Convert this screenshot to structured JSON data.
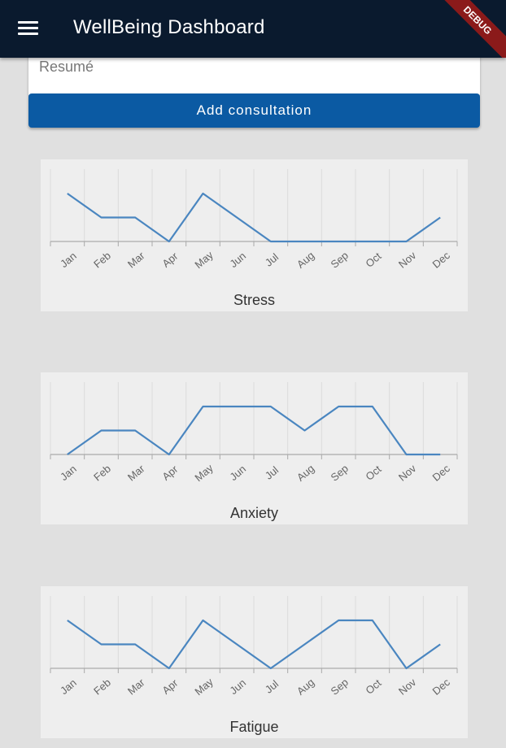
{
  "appbar": {
    "title": "WellBeing Dashboard",
    "menu_icon": "menu-icon",
    "debug_label": "DEBUG",
    "background": "#0a1a2e"
  },
  "form": {
    "resume_placeholder": "Resumé",
    "add_button_label": "Add consultation",
    "button_color": "#0b5aa3"
  },
  "chart_data": [
    {
      "type": "line",
      "title": "Stress",
      "categories": [
        "Jan",
        "Feb",
        "Mar",
        "Apr",
        "May",
        "Jun",
        "Jul",
        "Aug",
        "Sep",
        "Oct",
        "Nov",
        "Dec"
      ],
      "values": [
        2,
        1,
        1,
        0,
        2,
        1,
        0,
        0,
        0,
        0,
        0,
        1
      ],
      "ylim": [
        0,
        2.2
      ],
      "grid": true,
      "line_color": "#4a86c0"
    },
    {
      "type": "line",
      "title": "Anxiety",
      "categories": [
        "Jan",
        "Feb",
        "Mar",
        "Apr",
        "May",
        "Jun",
        "Jul",
        "Aug",
        "Sep",
        "Oct",
        "Nov",
        "Dec"
      ],
      "values": [
        0,
        1,
        1,
        0,
        2,
        2,
        2,
        1,
        2,
        2,
        0,
        0
      ],
      "ylim": [
        0,
        2.2
      ],
      "grid": true,
      "line_color": "#4a86c0"
    },
    {
      "type": "line",
      "title": "Fatigue",
      "categories": [
        "Jan",
        "Feb",
        "Mar",
        "Apr",
        "May",
        "Jun",
        "Jul",
        "Aug",
        "Sep",
        "Oct",
        "Nov",
        "Dec"
      ],
      "values": [
        2,
        1,
        1,
        0,
        2,
        1,
        0,
        1,
        2,
        2,
        0,
        1
      ],
      "ylim": [
        0,
        2.2
      ],
      "grid": true,
      "line_color": "#4a86c0"
    }
  ]
}
